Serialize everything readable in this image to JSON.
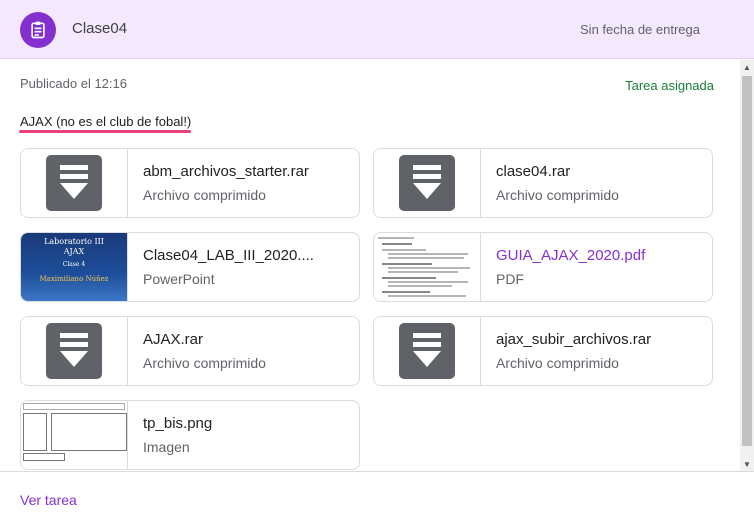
{
  "header": {
    "title": "Clase04",
    "due": "Sin fecha de entrega",
    "icon": "assignment-icon"
  },
  "content": {
    "published": "Publicado el 12:16",
    "status": "Tarea asignada",
    "description": "AJAX (no es el club de fobal!)"
  },
  "attachments": [
    {
      "name": "abm_archivos_starter.rar",
      "type": "Archivo comprimido",
      "thumb": "download-icon"
    },
    {
      "name": "clase04.rar",
      "type": "Archivo comprimido",
      "thumb": "download-icon"
    },
    {
      "name": "Clase04_LAB_III_2020....",
      "type": "PowerPoint",
      "thumb": "slide-preview",
      "slide": {
        "line1": "Laboratorio III",
        "line2": "AJAX",
        "line3": "Clase 4",
        "line4": "Maximiliano Núñez"
      }
    },
    {
      "name": "GUIA_AJAX_2020.pdf",
      "type": "PDF",
      "thumb": "pdf-preview"
    },
    {
      "name": "AJAX.rar",
      "type": "Archivo comprimido",
      "thumb": "download-icon"
    },
    {
      "name": "ajax_subir_archivos.rar",
      "type": "Archivo comprimido",
      "thumb": "download-icon"
    },
    {
      "name": "tp_bis.png",
      "type": "Imagen",
      "thumb": "image-preview"
    }
  ],
  "footer": {
    "link": "Ver tarea"
  },
  "colors": {
    "accent": "#8430ce",
    "header_bg": "#f3e8fd",
    "status_green": "#188038",
    "underline_pink": "#ec407a"
  }
}
